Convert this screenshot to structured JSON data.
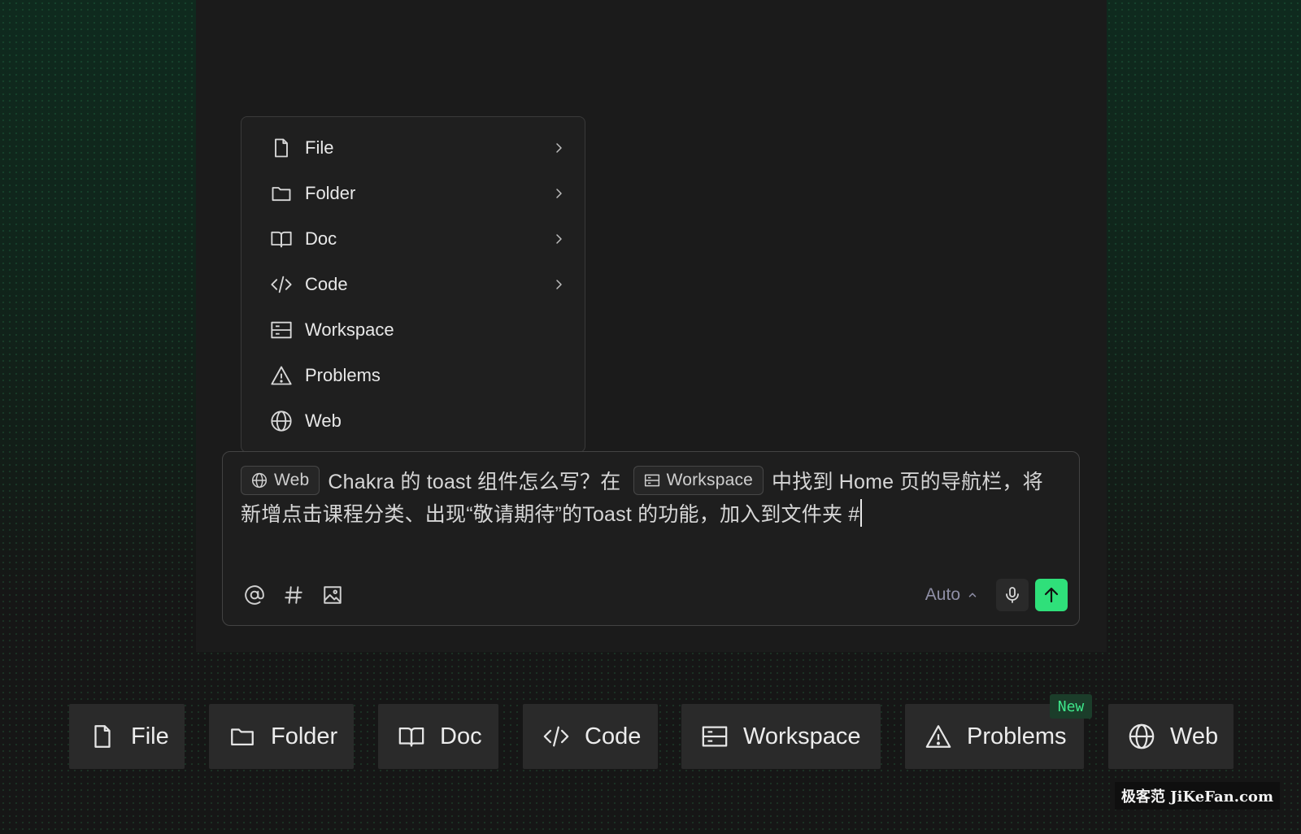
{
  "menu": {
    "items": [
      {
        "label": "File",
        "icon": "file-icon",
        "has_submenu": true
      },
      {
        "label": "Folder",
        "icon": "folder-icon",
        "has_submenu": true
      },
      {
        "label": "Doc",
        "icon": "book-icon",
        "has_submenu": true
      },
      {
        "label": "Code",
        "icon": "code-icon",
        "has_submenu": true
      },
      {
        "label": "Workspace",
        "icon": "workspace-icon",
        "has_submenu": false
      },
      {
        "label": "Problems",
        "icon": "warning-icon",
        "has_submenu": false
      },
      {
        "label": "Web",
        "icon": "globe-icon",
        "has_submenu": false
      }
    ]
  },
  "composer": {
    "chip_web": "Web",
    "text_1": "Chakra 的 toast 组件怎么写？在",
    "chip_workspace": "Workspace",
    "text_2": "中找到 Home 页的导航栏，将新增点击课程分类、出现“敬请期待”的Toast 的功能，加入到文件夹 #",
    "model_label": "Auto"
  },
  "bottom_bar": {
    "items": [
      {
        "label": "File",
        "icon": "file-icon"
      },
      {
        "label": "Folder",
        "icon": "folder-icon"
      },
      {
        "label": "Doc",
        "icon": "book-icon"
      },
      {
        "label": "Code",
        "icon": "code-icon"
      },
      {
        "label": "Workspace",
        "icon": "workspace-icon"
      },
      {
        "label": "Problems",
        "icon": "warning-icon"
      },
      {
        "label": "Web",
        "icon": "globe-icon"
      }
    ],
    "new_badge": "New"
  },
  "watermark": "极客范 JiKeFan.com",
  "colors": {
    "accent": "#2fe07a",
    "background": "#1b1b1b",
    "badge_text": "#3ee68a"
  }
}
